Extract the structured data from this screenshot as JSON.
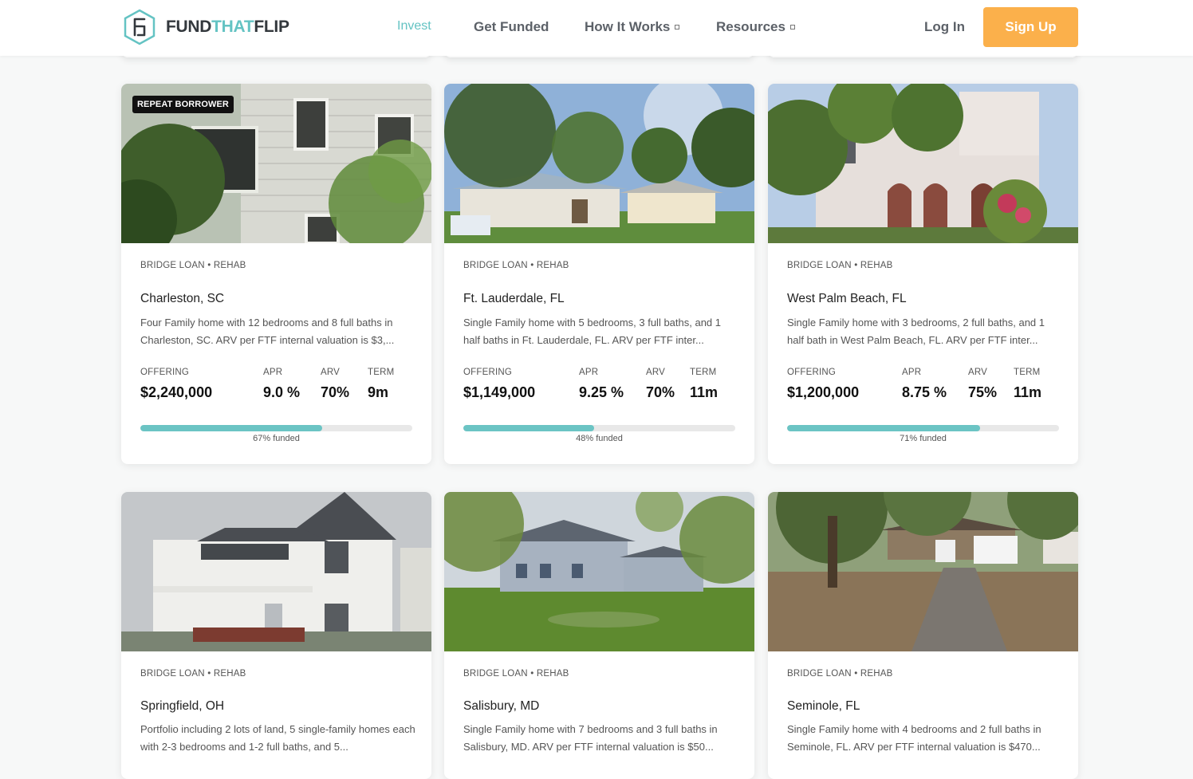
{
  "brand": {
    "part1": "FUND",
    "part2": "THAT",
    "part3": "FLIP",
    "accent": "#64c3c3",
    "dark": "#33383d"
  },
  "nav": {
    "items": [
      {
        "label": "Invest"
      },
      {
        "label": "Get Funded"
      },
      {
        "label": "How It Works"
      },
      {
        "label": "Resources"
      }
    ],
    "login": "Log In",
    "signup": "Sign Up",
    "signup_color": "#fbb04b"
  },
  "cards": [
    {
      "badge": "REPEAT BORROWER",
      "tags": "BRIDGE LOAN • REHAB",
      "city": "Charleston, SC",
      "description": "Four Family home with 12 bedrooms and 8 full baths in Charleston, SC. ARV per FTF internal valuation is $3,...",
      "labels": {
        "offering": "OFFERING",
        "apr": "APR",
        "arv": "ARV",
        "term": "TERM"
      },
      "offering": "$2,240,000",
      "apr": "9.0 %",
      "arv": "70%",
      "term": "9m",
      "funded_pct": 67,
      "funded_text": "67% funded"
    },
    {
      "badge": "",
      "tags": "BRIDGE LOAN • REHAB",
      "city": "Ft. Lauderdale, FL",
      "description": "Single Family home with 5 bedrooms, 3 full baths, and 1 half baths in Ft. Lauderdale, FL. ARV per FTF inter...",
      "labels": {
        "offering": "OFFERING",
        "apr": "APR",
        "arv": "ARV",
        "term": "TERM"
      },
      "offering": "$1,149,000",
      "apr": "9.25 %",
      "arv": "70%",
      "term": "11m",
      "funded_pct": 48,
      "funded_text": "48% funded"
    },
    {
      "badge": "",
      "tags": "BRIDGE LOAN • REHAB",
      "city": "West Palm Beach, FL",
      "description": "Single Family home with 3 bedrooms, 2 full baths, and 1 half bath in West Palm Beach, FL. ARV per FTF inter...",
      "labels": {
        "offering": "OFFERING",
        "apr": "APR",
        "arv": "ARV",
        "term": "TERM"
      },
      "offering": "$1,200,000",
      "apr": "8.75 %",
      "arv": "75%",
      "term": "11m",
      "funded_pct": 71,
      "funded_text": "71% funded"
    },
    {
      "badge": "",
      "tags": "BRIDGE LOAN • REHAB",
      "city": "Springfield, OH",
      "description": "Portfolio including 2 lots of land, 5 single-family homes each with 2-3 bedrooms and 1-2 full baths, and 5..."
    },
    {
      "badge": "",
      "tags": "BRIDGE LOAN • REHAB",
      "city": "Salisbury, MD",
      "description": "Single Family home with 7 bedrooms and 3 full baths in Salisbury, MD. ARV per FTF internal valuation is $50..."
    },
    {
      "badge": "",
      "tags": "BRIDGE LOAN • REHAB",
      "city": "Seminole, FL",
      "description": "Single Family home with 4 bedrooms and 2 full baths in Seminole, FL. ARV per FTF internal valuation is $470..."
    }
  ]
}
